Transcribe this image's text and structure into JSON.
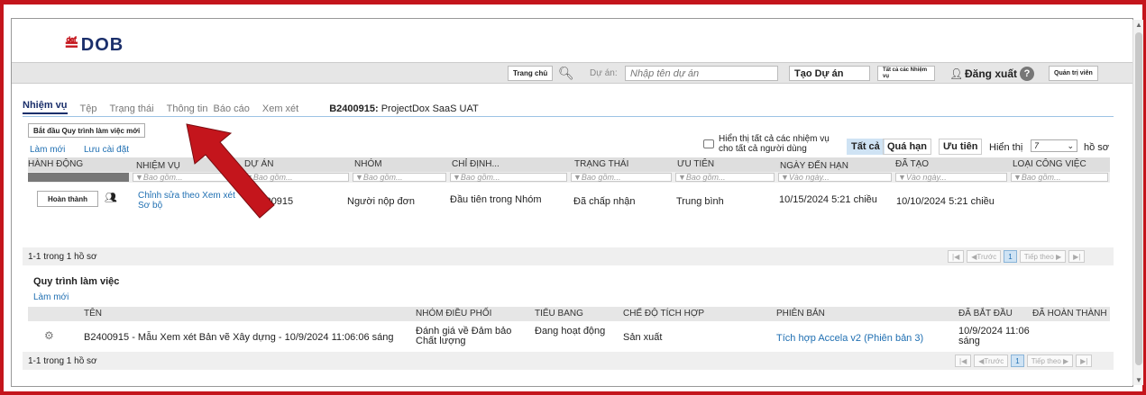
{
  "logo": {
    "text": "DOB"
  },
  "topbar": {
    "home": "Trang chủ",
    "project_label": "Dự án:",
    "project_placeholder": "Nhập tên dự án",
    "create_project": "Tạo Dự án",
    "all_tasks": "Tất cả các Nhiệm vụ",
    "logout": "Đăng xuất",
    "admin": "Quản trị viên"
  },
  "tabs": [
    {
      "label": "Nhiệm vụ"
    },
    {
      "label": "Tệp"
    },
    {
      "label": "Trạng thái"
    },
    {
      "label": "Thông tin"
    },
    {
      "label": "Báo cáo"
    },
    {
      "label": "Xem xét"
    }
  ],
  "project_title": {
    "id": "B2400915:",
    "name": "ProjectDox SaaS UAT"
  },
  "tasks": {
    "start_workflow": "Bắt đầu Quy trình làm việc mới",
    "refresh": "Làm mới",
    "save_settings": "Lưu cài đặt",
    "show_all_users": "Hiển thị tất cả các nhiệm vụ cho tất cả người dùng",
    "filters": [
      "Tất cả",
      "Quá hạn",
      "Ưu tiên"
    ],
    "show_label": "Hiển thị",
    "show_value": "7",
    "records_label": "hồ sơ",
    "columns": [
      "HÀNH ĐỘNG",
      "NHIỆM VỤ",
      "DỰ ÁN",
      "NHÓM",
      "CHỈ ĐỊNH...",
      "TRẠNG THÁI",
      "ƯU TIÊN",
      "NGÀY ĐẾN HẠN",
      "ĐÃ TẠO",
      "LOẠI CÔNG VIỆC"
    ],
    "filter_placeholder": "Bao gồm...",
    "filter_date_placeholder": "Vào ngày...",
    "row": {
      "action": "Hoàn thành",
      "task": "Chỉnh sửa theo Xem xét Sơ bộ",
      "project": "B2400915",
      "group": "Người nộp đơn",
      "assigned": "Đầu tiên trong Nhóm",
      "status": "Đã chấp nhận",
      "priority": "Trung bình",
      "due": "10/15/2024 5:21 chiều",
      "created": "10/10/2024 5:21 chiều"
    },
    "count": "1-1 trong 1 hồ sơ"
  },
  "pager": {
    "prev": "Trước",
    "page": "1",
    "next": "Tiếp theo"
  },
  "workflow": {
    "title": "Quy trình làm việc",
    "refresh": "Làm mới",
    "columns": [
      "TÊN",
      "NHÓM ĐIỀU PHỐI",
      "TIỂU BANG",
      "CHẾ ĐỘ TÍCH HỢP",
      "PHIÊN BẢN",
      "ĐÃ BẮT ĐẦU",
      "ĐÃ HOÀN THÀNH"
    ],
    "row": {
      "name": "B2400915 - Mẫu Xem xét Bản vẽ Xây dựng - 10/9/2024 11:06:06 sáng",
      "group": "Đánh giá về Đảm bảo Chất lượng",
      "state": "Đang hoạt động",
      "mode": "Sản xuất",
      "version": "Tích hợp Accela v2 (Phiên bản 3)",
      "started": "10/9/2024 11:06 sáng"
    },
    "count": "1-1 trong 1 hồ sơ"
  },
  "colors": {
    "accent": "#1b2f6b",
    "link": "#1f6fb2",
    "frame": "#c4151c",
    "arrow": "#c4151c"
  }
}
